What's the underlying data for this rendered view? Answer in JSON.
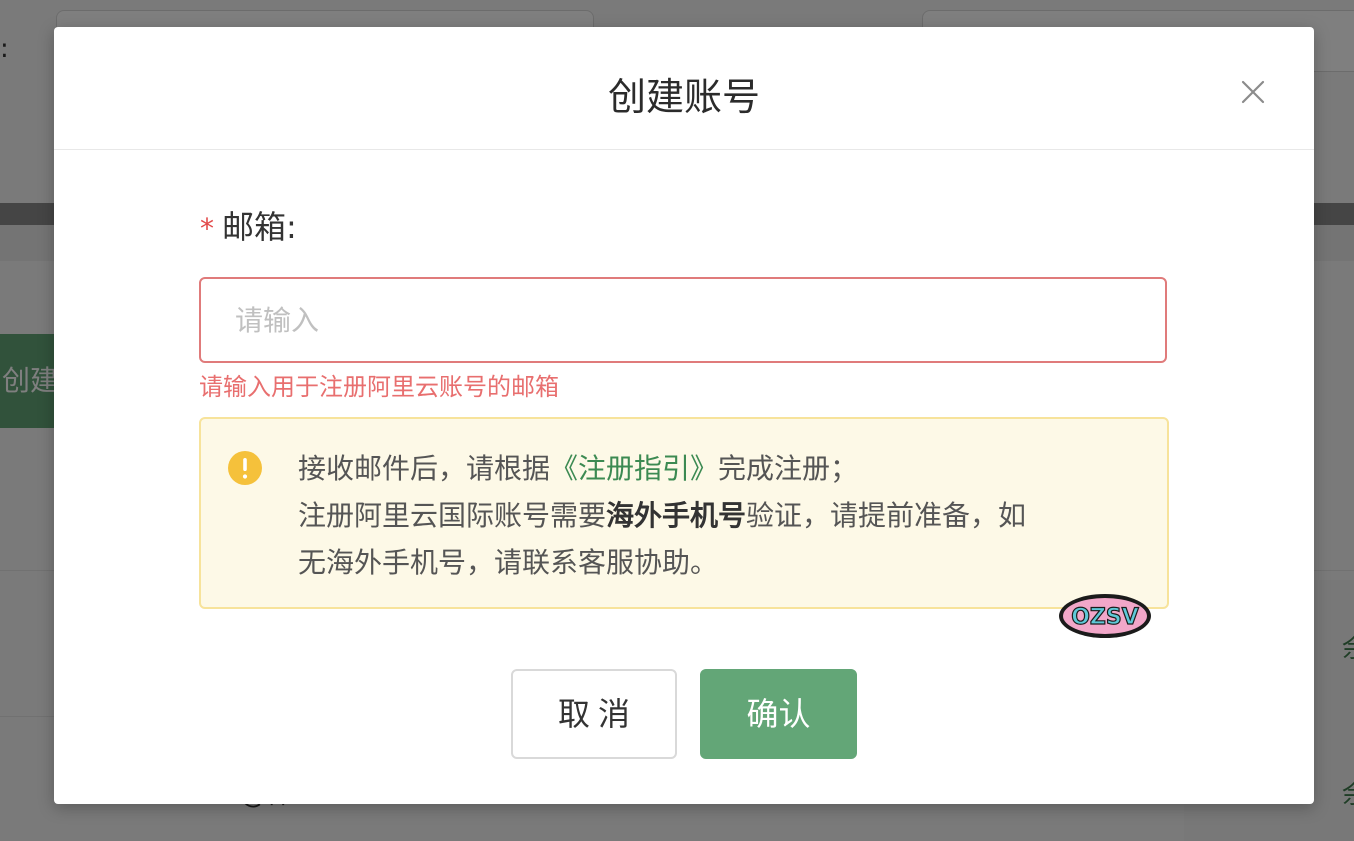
{
  "background": {
    "create_button_label": "创建",
    "colon": ":",
    "bottom_glyph": "@样",
    "right_glyph": "余"
  },
  "dialog": {
    "title": "创建账号",
    "close_icon": "close-icon",
    "field": {
      "required_mark": "*",
      "label": "邮箱:",
      "placeholder": "请输入",
      "value": "",
      "error": "请输入用于注册阿里云账号的邮箱"
    },
    "notice": {
      "icon": "warning-icon",
      "line1_prefix": "接收邮件后，请根据",
      "guide_link": "《注册指引》",
      "line1_suffix": "完成注册；",
      "line2_prefix": "注册阿里云国际账号需要",
      "line2_bold": "海外手机号",
      "line2_suffix": "验证，请提前准备，如",
      "line3": "无海外手机号，请联系客服协助。"
    },
    "sticker_text": "OZSV",
    "cancel_label": "取消",
    "confirm_label": "确认"
  },
  "colors": {
    "primary": "#63a677",
    "error": "#e86f6f",
    "warning_bg": "#fdf9e7",
    "warning_border": "#f7e39b",
    "warning_icon": "#f5c13b"
  }
}
